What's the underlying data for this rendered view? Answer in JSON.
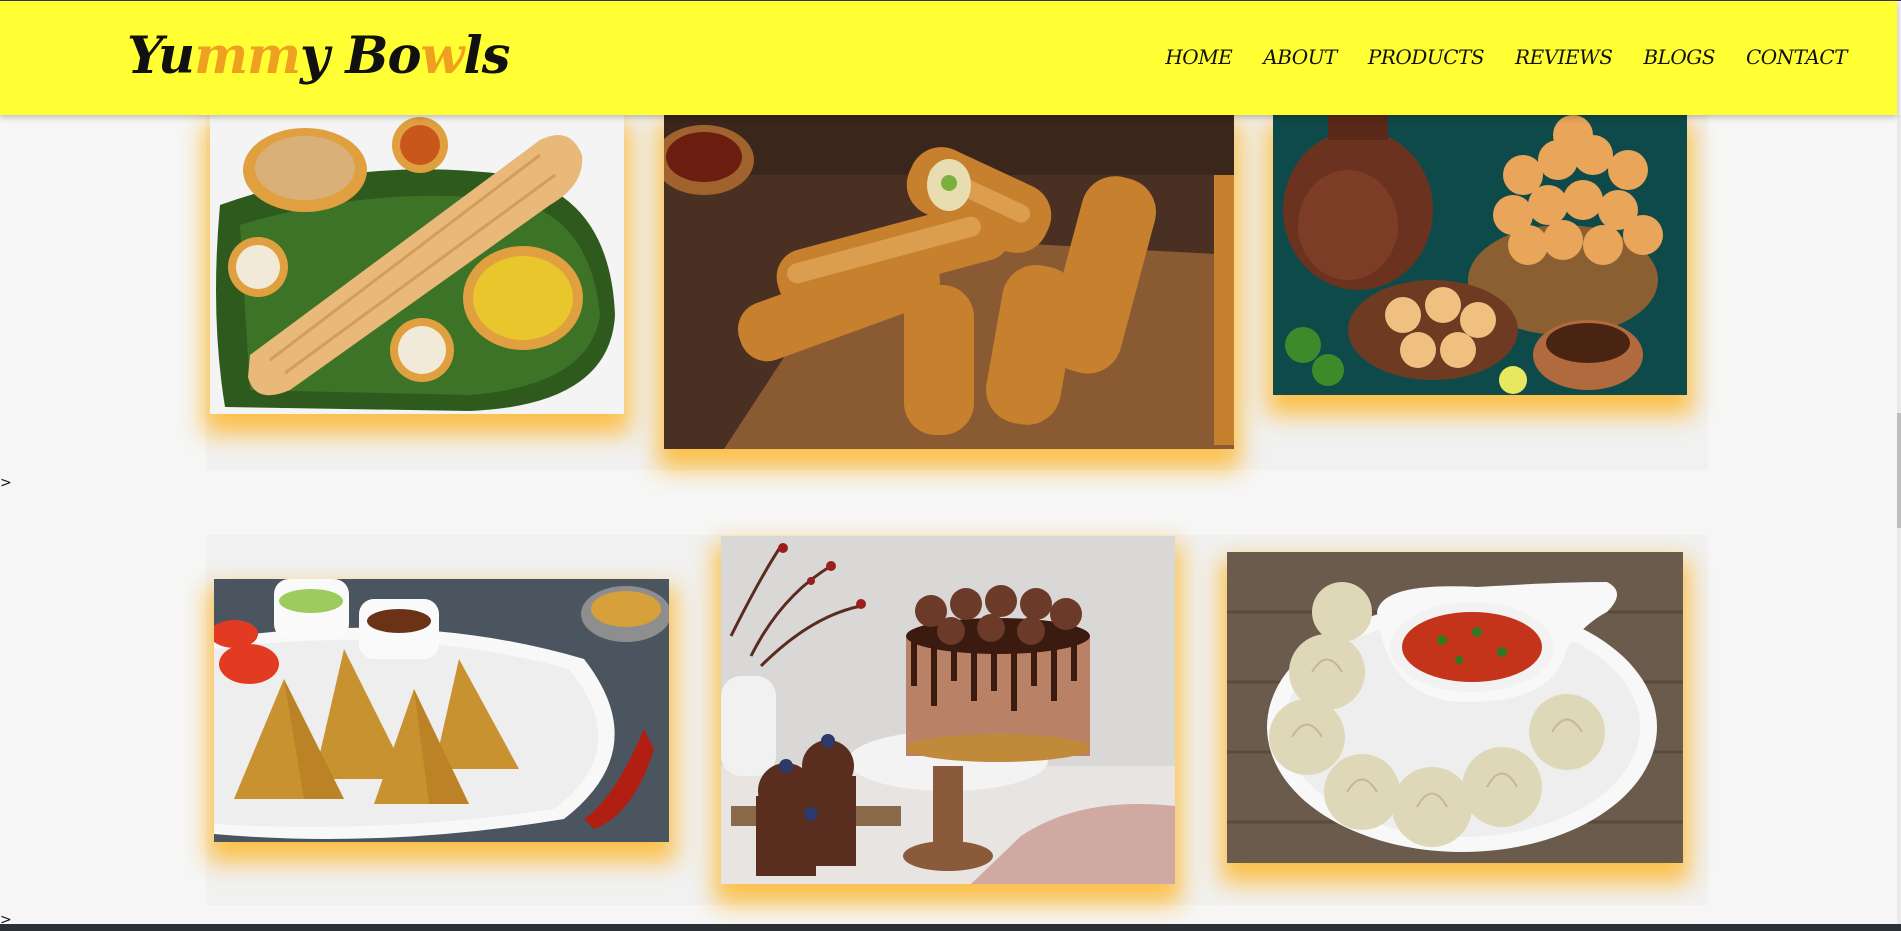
{
  "brand": {
    "logo_parts": [
      {
        "text": "Yu",
        "accent": false
      },
      {
        "text": "mm",
        "accent": true
      },
      {
        "text": "y Bo",
        "accent": false
      },
      {
        "text": "w",
        "accent": true
      },
      {
        "text": "ls",
        "accent": false
      }
    ]
  },
  "nav": {
    "items": [
      "HOME",
      "ABOUT",
      "PRODUCTS",
      "REVIEWS",
      "BLOGS",
      "CONTACT"
    ]
  },
  "stray_text": [
    ">",
    ">"
  ],
  "gallery": {
    "row1": [
      "dosa-icon",
      "spring-rolls-icon",
      "pani-puri-icon"
    ],
    "row2": [
      "samosa-icon",
      "chocolate-cake-icon",
      "momos-icon"
    ]
  },
  "colors": {
    "header_bg": "#ffff33",
    "accent": "#f0a020",
    "card_glow": "#ffb014",
    "page_bg": "#f6f6f6"
  }
}
